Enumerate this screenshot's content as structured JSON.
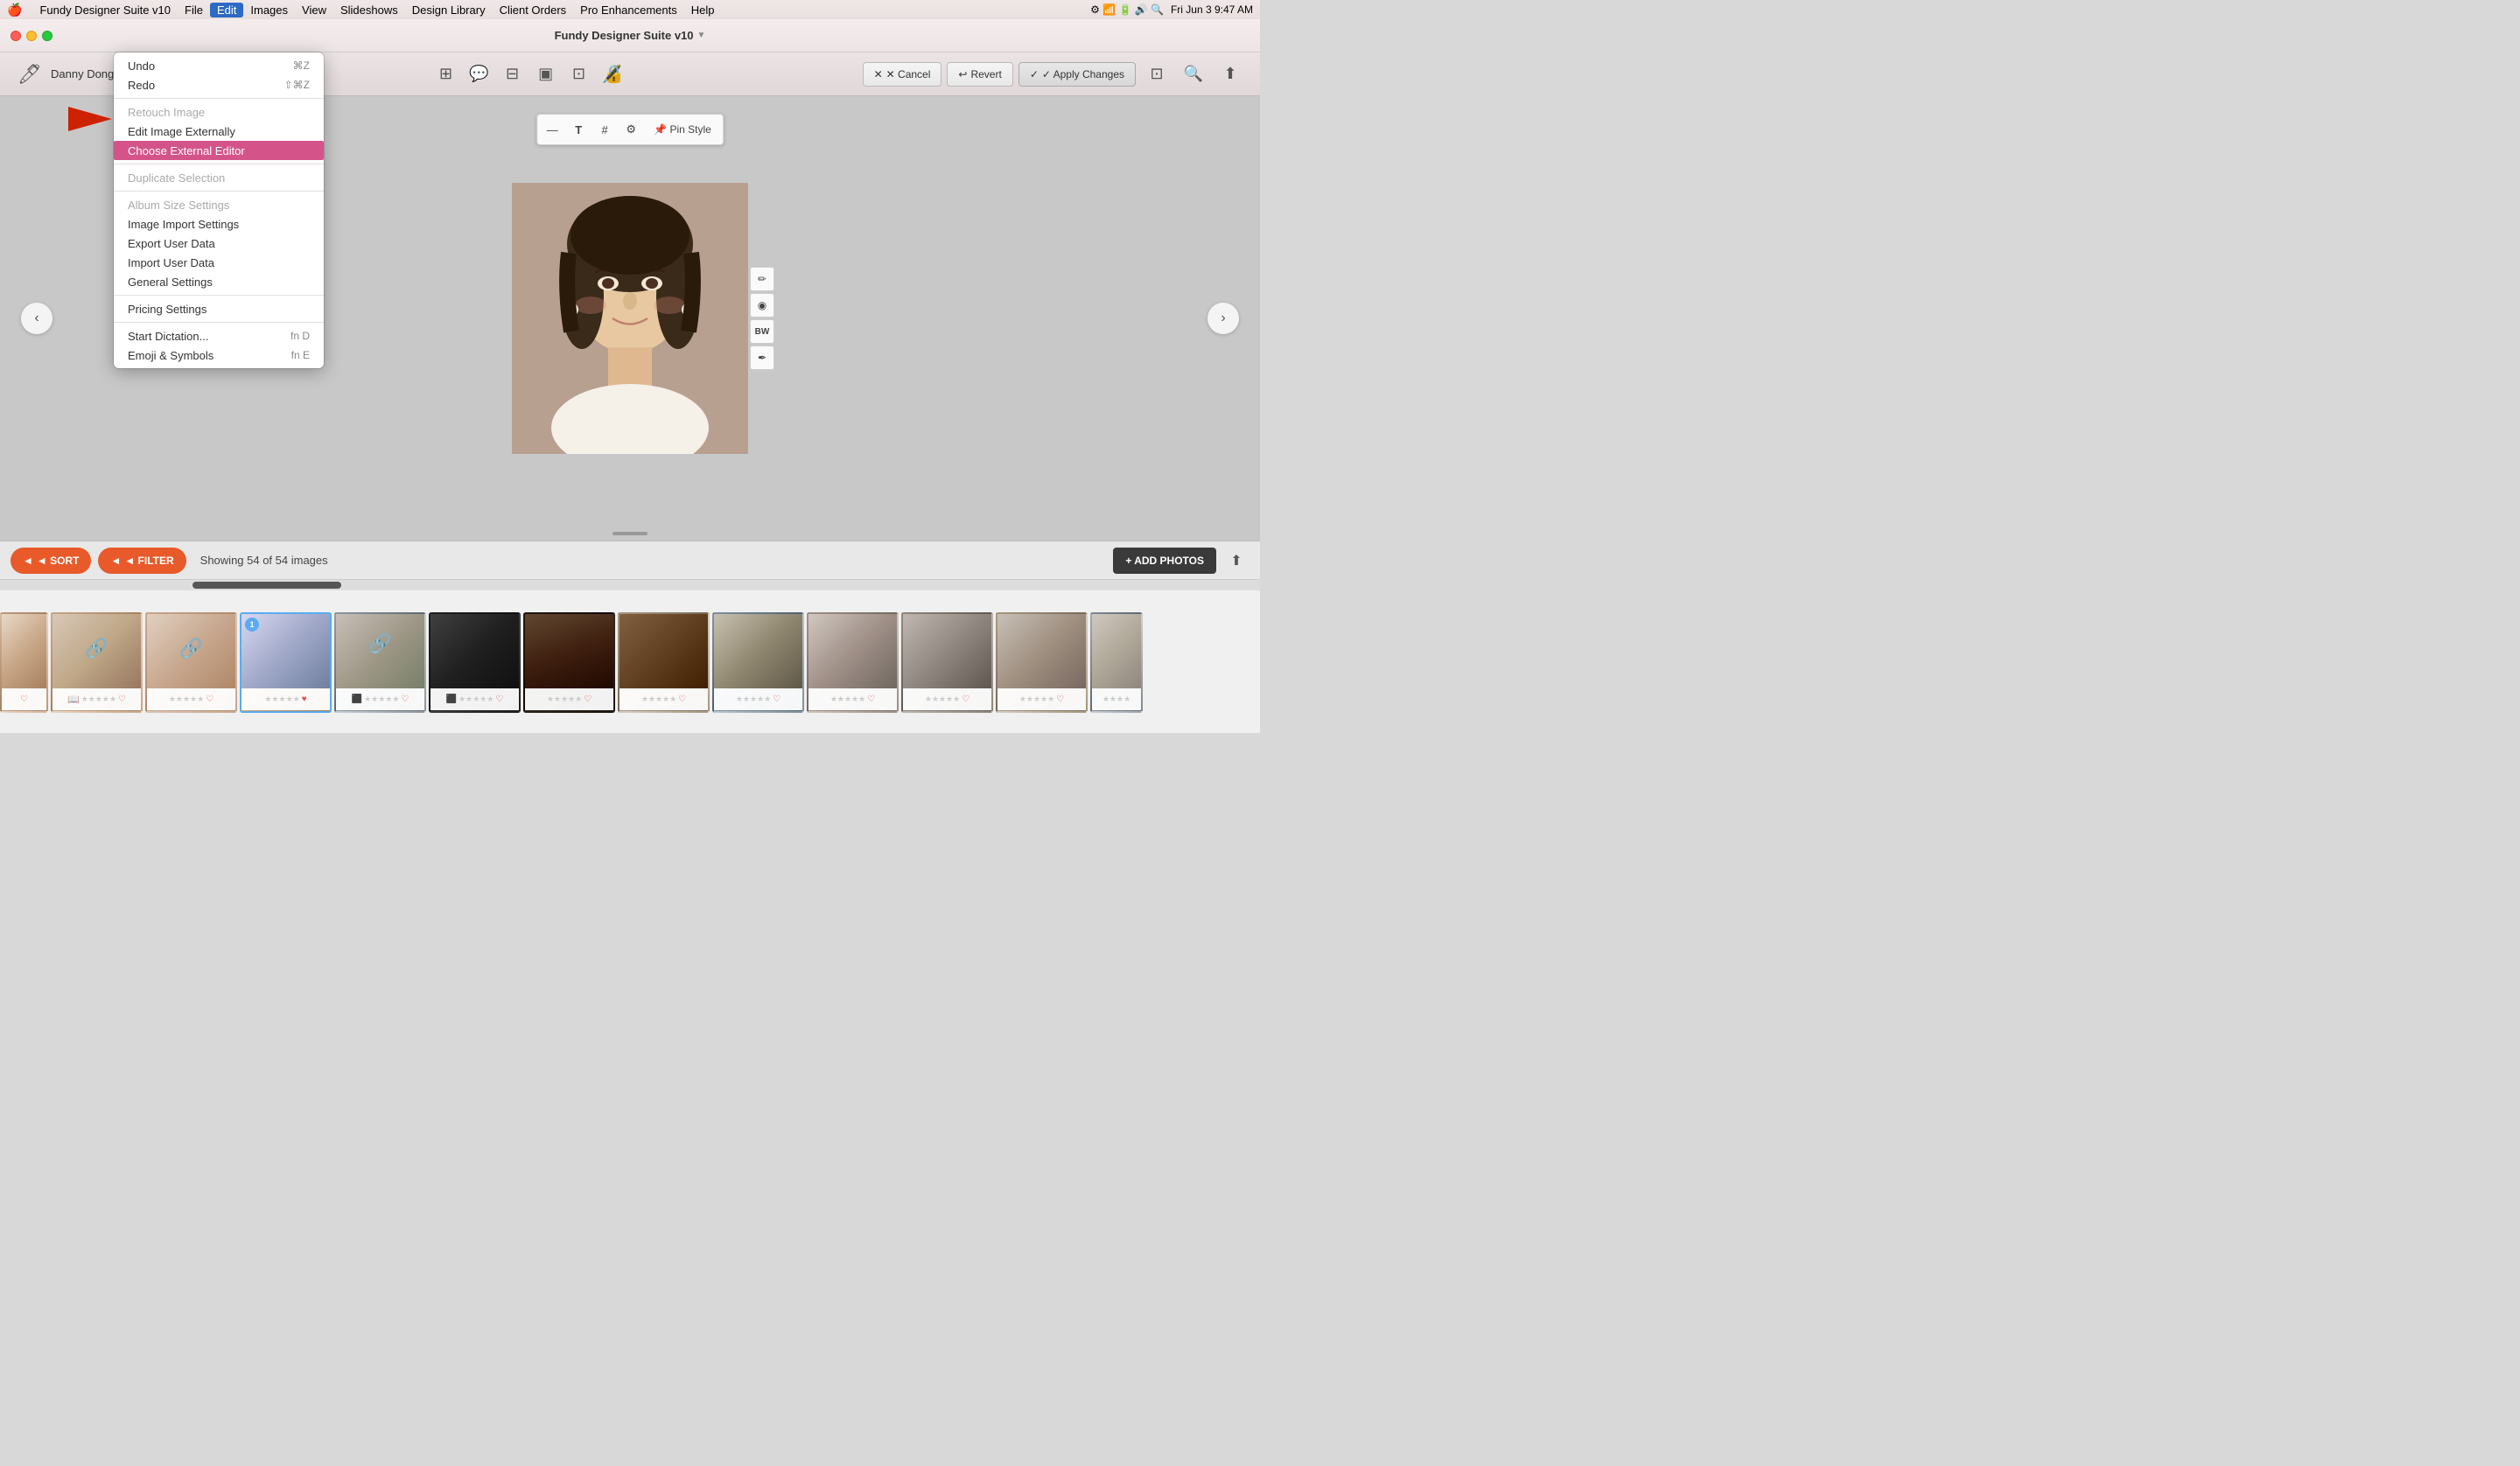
{
  "menubar": {
    "apple": "🍎",
    "items": [
      {
        "label": "Fundy Designer Suite v10",
        "active": false
      },
      {
        "label": "File",
        "active": false
      },
      {
        "label": "Edit",
        "active": true
      },
      {
        "label": "Images",
        "active": false
      },
      {
        "label": "View",
        "active": false
      },
      {
        "label": "Slideshows",
        "active": false
      },
      {
        "label": "Design Library",
        "active": false
      },
      {
        "label": "Client Orders",
        "active": false
      },
      {
        "label": "Pro Enhancements",
        "active": false
      },
      {
        "label": "Help",
        "active": false
      }
    ],
    "right": {
      "time": "Fri Jun 3  9:47 AM"
    }
  },
  "titlebar": {
    "title": "Fundy Designer Suite v10",
    "indicator": "▼"
  },
  "toolbar": {
    "brand": "Danny Dong Photography",
    "buttons": {
      "cancel": "✕  Cancel",
      "revert": "↩  Revert",
      "apply": "✓  Apply Changes"
    }
  },
  "image_toolbar": {
    "dash": "—",
    "text": "T",
    "hash": "#",
    "tool": "🔧",
    "pin_style": "📌 Pin Style"
  },
  "side_tools": {
    "pencil": "✏",
    "globe": "🌐",
    "bw": "BW",
    "eyedropper": "✏"
  },
  "nav": {
    "left": "‹",
    "right": "›"
  },
  "bottom_panel": {
    "sort_label": "◄ SORT",
    "filter_label": "◄ FILTER",
    "count_label": "Showing 54 of 54 images",
    "add_photos": "+ ADD PHOTOS"
  },
  "dropdown": {
    "items": [
      {
        "label": "Undo",
        "shortcut": "⌘Z",
        "enabled": true,
        "highlighted": false
      },
      {
        "label": "Redo",
        "shortcut": "⇧⌘Z",
        "enabled": true,
        "highlighted": false
      },
      {
        "separator_after": true
      },
      {
        "label": "Retouch Image",
        "shortcut": "",
        "enabled": false,
        "highlighted": false
      },
      {
        "label": "Edit Image Externally",
        "shortcut": "",
        "enabled": true,
        "highlighted": false
      },
      {
        "label": "Choose External Editor",
        "shortcut": "",
        "enabled": true,
        "highlighted": true
      },
      {
        "separator_after": true
      },
      {
        "label": "Duplicate Selection",
        "shortcut": "",
        "enabled": false,
        "highlighted": false
      },
      {
        "separator_after": true
      },
      {
        "label": "Album Size Settings",
        "shortcut": "",
        "enabled": false,
        "highlighted": false
      },
      {
        "label": "Image Import Settings",
        "shortcut": "",
        "enabled": true,
        "highlighted": false
      },
      {
        "label": "Export User Data",
        "shortcut": "",
        "enabled": true,
        "highlighted": false
      },
      {
        "label": "Import User Data",
        "shortcut": "",
        "enabled": true,
        "highlighted": false
      },
      {
        "label": "General Settings",
        "shortcut": "",
        "enabled": true,
        "highlighted": false
      },
      {
        "separator_after": true
      },
      {
        "label": "Pricing Settings",
        "shortcut": "",
        "enabled": true,
        "highlighted": false
      },
      {
        "separator_after": true
      },
      {
        "label": "Start Dictation...",
        "shortcut": "fn D",
        "enabled": true,
        "highlighted": false
      },
      {
        "label": "Emoji & Symbols",
        "shortcut": "fn E",
        "enabled": true,
        "highlighted": false
      }
    ]
  },
  "thumbnails": [
    {
      "id": 1,
      "bg": "thumb-bg-1",
      "selected": false,
      "linked": true,
      "badge": null,
      "icon_left": "📖",
      "icon_right": null
    },
    {
      "id": 2,
      "bg": "thumb-bg-2",
      "selected": false,
      "linked": true,
      "badge": null,
      "icon_left": null,
      "icon_right": null
    },
    {
      "id": 3,
      "bg": "thumb-bg-3",
      "selected": false,
      "linked": true,
      "badge": null,
      "icon_left": null,
      "icon_right": null
    },
    {
      "id": 4,
      "bg": "thumb-bg-1",
      "selected": true,
      "linked": false,
      "badge": "1",
      "icon_left": null,
      "icon_right": null
    },
    {
      "id": 5,
      "bg": "thumb-bg-4",
      "selected": false,
      "linked": false,
      "badge": null,
      "icon_left": "⬛",
      "icon_right": null
    },
    {
      "id": 6,
      "bg": "thumb-bg-5",
      "selected": false,
      "linked": false,
      "badge": null,
      "icon_left": "⬛",
      "icon_right": null
    },
    {
      "id": 7,
      "bg": "thumb-bg-6",
      "selected": false,
      "linked": false,
      "badge": null,
      "icon_left": null,
      "icon_right": null
    },
    {
      "id": 8,
      "bg": "thumb-bg-7",
      "selected": false,
      "linked": false,
      "badge": null,
      "icon_left": null,
      "icon_right": null
    },
    {
      "id": 9,
      "bg": "thumb-bg-8",
      "selected": false,
      "linked": false,
      "badge": null,
      "icon_left": null,
      "icon_right": null
    },
    {
      "id": 10,
      "bg": "thumb-bg-9",
      "selected": false,
      "linked": false,
      "badge": null,
      "icon_left": null,
      "icon_right": null
    },
    {
      "id": 11,
      "bg": "thumb-bg-10",
      "selected": false,
      "linked": false,
      "badge": null,
      "icon_left": null,
      "icon_right": null
    },
    {
      "id": 12,
      "bg": "thumb-bg-7",
      "selected": false,
      "linked": false,
      "badge": null,
      "icon_left": null,
      "icon_right": null
    },
    {
      "id": 13,
      "bg": "thumb-bg-4",
      "selected": false,
      "linked": false,
      "badge": null,
      "icon_left": null,
      "icon_right": null
    }
  ]
}
